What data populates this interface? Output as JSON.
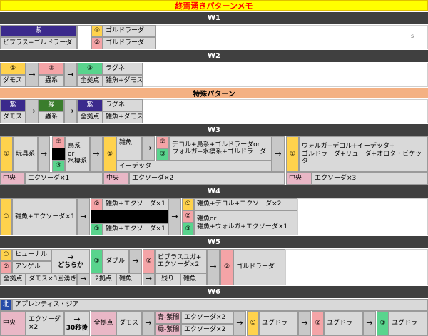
{
  "title": "終焉湧きパターンメモ",
  "w1": {
    "header": "W1",
    "purple": "紫",
    "left_bottom": "ビブラス+ゴルドラーダ",
    "n1": "①",
    "n2": "②",
    "r1": "ゴルドラーダ",
    "r2": "ゴルドラーダ",
    "mark": "s"
  },
  "w2": {
    "header": "W2",
    "n1": "①",
    "n2": "②",
    "n3": "③",
    "b1": "ダモス",
    "b2": "蟲系",
    "b3": "全拠点",
    "r_top": "ラグネ",
    "r_bottom": "雑魚+ダモス",
    "arrow": "→"
  },
  "special": {
    "header": "特殊パターン",
    "purple1": "紫",
    "green": "緑",
    "purple2": "紫",
    "b1": "ダモス",
    "b2": "蟲系",
    "b3": "全拠点",
    "r_top": "ラグネ",
    "r_bottom": "雑魚+ダモス",
    "arrow": "→"
  },
  "w3": {
    "header": "W3",
    "n1": "①",
    "n2": "②",
    "n3": "③",
    "toy": "玩具系",
    "alt": "鳥系or\n水棲系",
    "zako": "雑魚",
    "opt2": "デコル+鳥系+ゴルドラーダor\nウォルガ+水棲系+ゴルドラーダ",
    "ideta": "イーデッタ",
    "final": "ウォルガ+デコル+イーデッタ+\nゴルドラーダ+リューダ+オロタ・ビケッタ",
    "center": "中央",
    "ex1": "エクソーダ×1",
    "ex2": "エクソーダ×2",
    "ex3": "エクソーダ×3",
    "arrow": "→"
  },
  "w4": {
    "header": "W4",
    "n1": "①",
    "n2": "②",
    "n3": "③",
    "left": "雑魚+エクソーダ×1",
    "m_top": "雑魚+エクソーダ×1",
    "m_bottom": "雑魚+エクソーダ×1",
    "r_top": "雑魚+デコル+エクソーダ×2",
    "r_bottom": "雑魚or\n雑魚+ウォルガ+エクソーダ×1",
    "arrow": "→"
  },
  "w5": {
    "header": "W5",
    "n1": "①",
    "n2": "②",
    "n3": "③",
    "hunal": "ヒューナル",
    "angel": "アンゲル",
    "base": "全拠点",
    "damos": "ダモス×3回湧き",
    "dochira": "どちらか",
    "double": "ダブル",
    "two_base": "2拠点",
    "zako": "雑魚",
    "bib": "ビブラスユガ+\nエクソーダ×2",
    "remain": "残り",
    "zako2": "雑魚",
    "gold": "ゴルドラーダ",
    "arrow": "→"
  },
  "w6": {
    "header": "W6",
    "north": "北",
    "apr": "アプレンティス・ジア",
    "center": "中央",
    "ex2": "エクソーダ\n×2",
    "s30": "30秒後",
    "base": "全拠点",
    "damos": "ダモス",
    "blue_purple": "青-紫闇",
    "green_purple": "緑-紫闇",
    "ex2b": "エクソーダ×2",
    "ex2c": "エクソーダ×2",
    "n1": "①",
    "n2": "②",
    "n3": "③",
    "yug1": "ユグドラ",
    "yug2": "ユグドラ",
    "yug3": "ユグドラ",
    "arrow": "→"
  }
}
